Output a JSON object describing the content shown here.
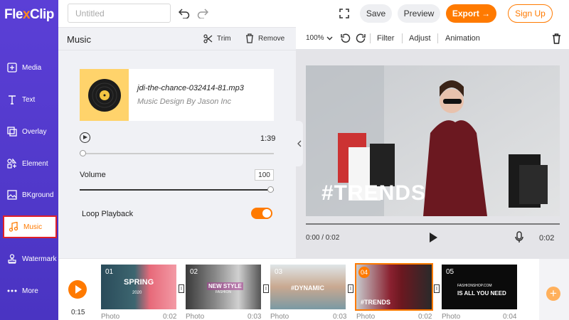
{
  "app": {
    "logo_prefix": "Fle",
    "logo_x": "x",
    "logo_suffix": "Clip",
    "brand_color": "#5b3fd6",
    "accent_color": "#ff7a00"
  },
  "topbar": {
    "title_placeholder": "Untitled",
    "title_value": "",
    "save_label": "Save",
    "preview_label": "Preview",
    "export_label": "Export →",
    "signup_label": "Sign Up"
  },
  "sidebar": {
    "items": [
      {
        "label": "Media",
        "icon": "media-icon",
        "active": false
      },
      {
        "label": "Text",
        "icon": "text-icon",
        "active": false
      },
      {
        "label": "Overlay",
        "icon": "overlay-icon",
        "active": false
      },
      {
        "label": "Element",
        "icon": "element-icon",
        "active": false
      },
      {
        "label": "BKground",
        "icon": "background-icon",
        "active": false
      },
      {
        "label": "Music",
        "icon": "music-note-icon",
        "active": true
      },
      {
        "label": "Watermark",
        "icon": "stamp-icon",
        "active": false
      },
      {
        "label": "More",
        "icon": "more-icon",
        "active": false
      }
    ]
  },
  "music_panel": {
    "title": "Music",
    "trim_label": "Trim",
    "remove_label": "Remove",
    "file_name": "jdi-the-chance-032414-81.mp3",
    "artist": "Music Design By Jason Inc",
    "duration": "1:39",
    "playback_progress": 0.0,
    "volume_label": "Volume",
    "volume_value": "100",
    "volume_level": 1.0,
    "loop_label": "Loop Playback",
    "loop_enabled": true
  },
  "editor_toolbar": {
    "zoom": "100%",
    "filter_label": "Filter",
    "adjust_label": "Adjust",
    "animation_label": "Animation"
  },
  "preview": {
    "overlay_text": "#TRENDS",
    "current_time": "0:00 / 0:02",
    "total_time": "0:02"
  },
  "timeline": {
    "current_time": "0:15",
    "clips": [
      {
        "num": "01",
        "text": "SPRING",
        "subtext": "2020",
        "type": "Photo",
        "duration": "0:02",
        "selected": false
      },
      {
        "num": "02",
        "text": "NEW STYLE",
        "subtext": "FASHION",
        "type": "Photo",
        "duration": "0:03",
        "selected": false
      },
      {
        "num": "03",
        "text": "#DYNAMIC",
        "subtext": "",
        "type": "Photo",
        "duration": "0:03",
        "selected": false
      },
      {
        "num": "04",
        "text": "#TRENDS",
        "subtext": "",
        "type": "Photo",
        "duration": "0:02",
        "selected": true
      },
      {
        "num": "05",
        "text": "IS ALL YOU NEED",
        "subtext": "FASHIONSHOP.COM",
        "type": "Photo",
        "duration": "0:04",
        "selected": false
      }
    ]
  }
}
